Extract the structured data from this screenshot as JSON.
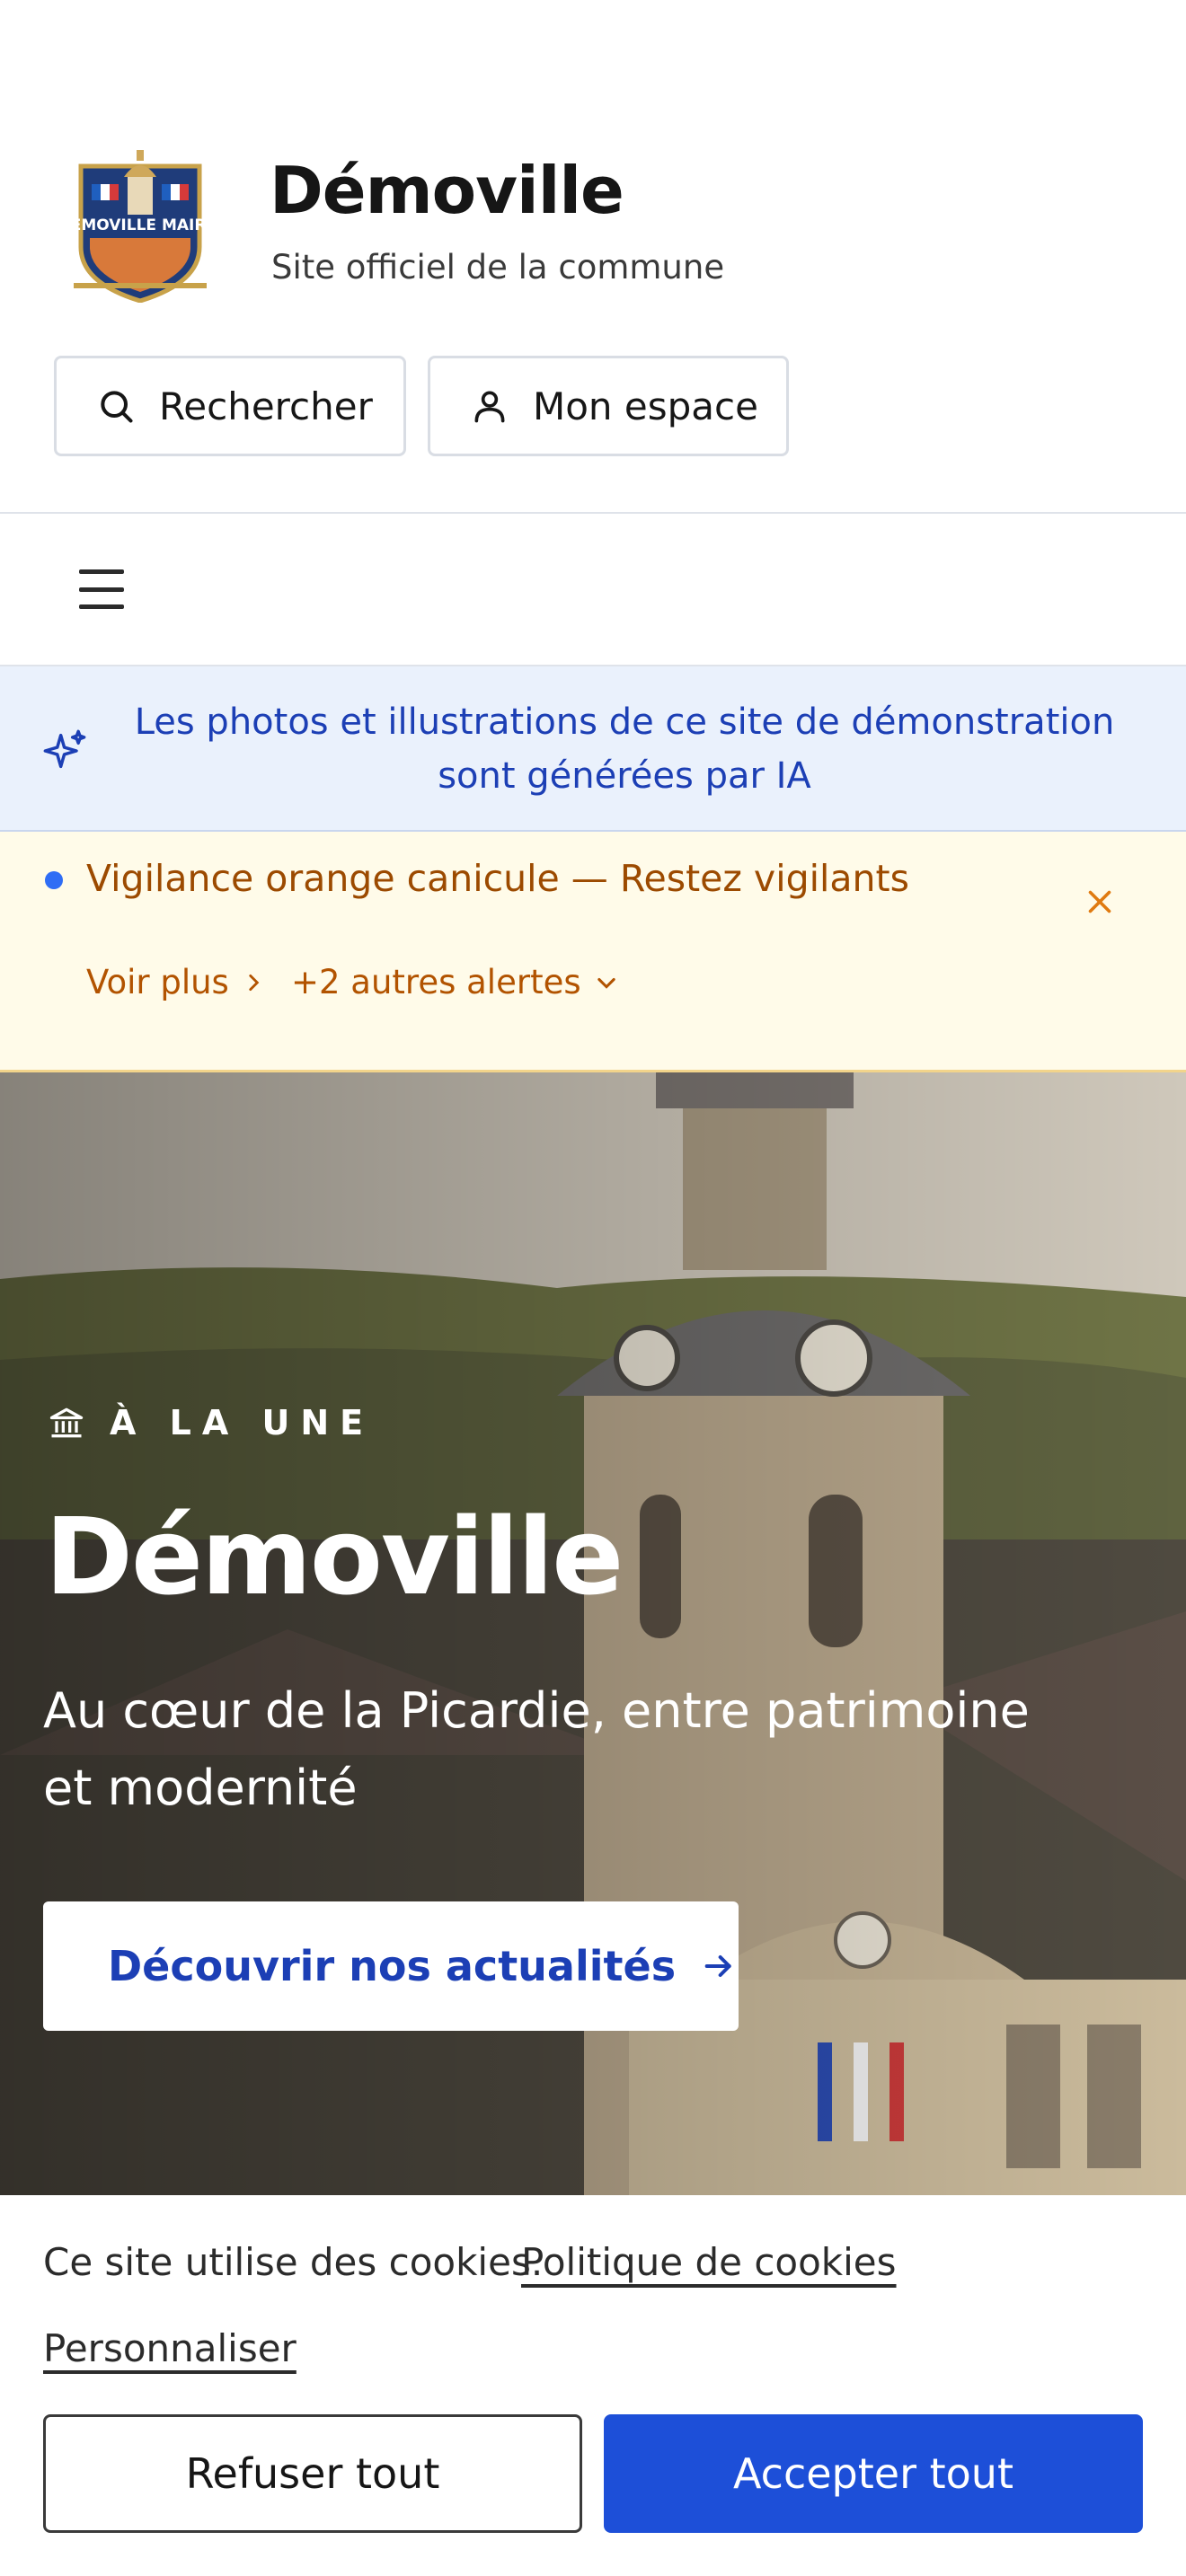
{
  "header": {
    "title": "Démoville",
    "subtitle": "Site officiel de la commune",
    "logo_text": "DÉMOVILLE MAIRIE",
    "search_label": "Rechercher",
    "account_label": "Mon espace"
  },
  "nav": {
    "menu_icon": "menu-icon"
  },
  "ai_notice": {
    "text": "Les photos et illustrations de ce site de démonstration sont générées par IA",
    "icon": "sparkles-icon"
  },
  "alert": {
    "title": "Vigilance orange canicule — Restez vigilants",
    "more_label": "Voir plus",
    "others_label": "+2 autres alertes"
  },
  "hero": {
    "kicker": "À LA UNE",
    "title": "Démoville",
    "subtitle": "Au cœur de la Picardie, entre patrimoine et modernité",
    "cta_label": "Découvrir nos actualités"
  },
  "cookie": {
    "text": "Ce site utilise des cookies.",
    "policy_link": "Politique de cookies",
    "customize_link": "Personnaliser",
    "refuse_label": "Refuser tout",
    "accept_label": "Accepter tout"
  },
  "colors": {
    "primary": "#1d4fd8",
    "alert_text": "#9c4a00",
    "alert_bg": "#fffbe9",
    "notice_bg": "#eaf1fc"
  }
}
